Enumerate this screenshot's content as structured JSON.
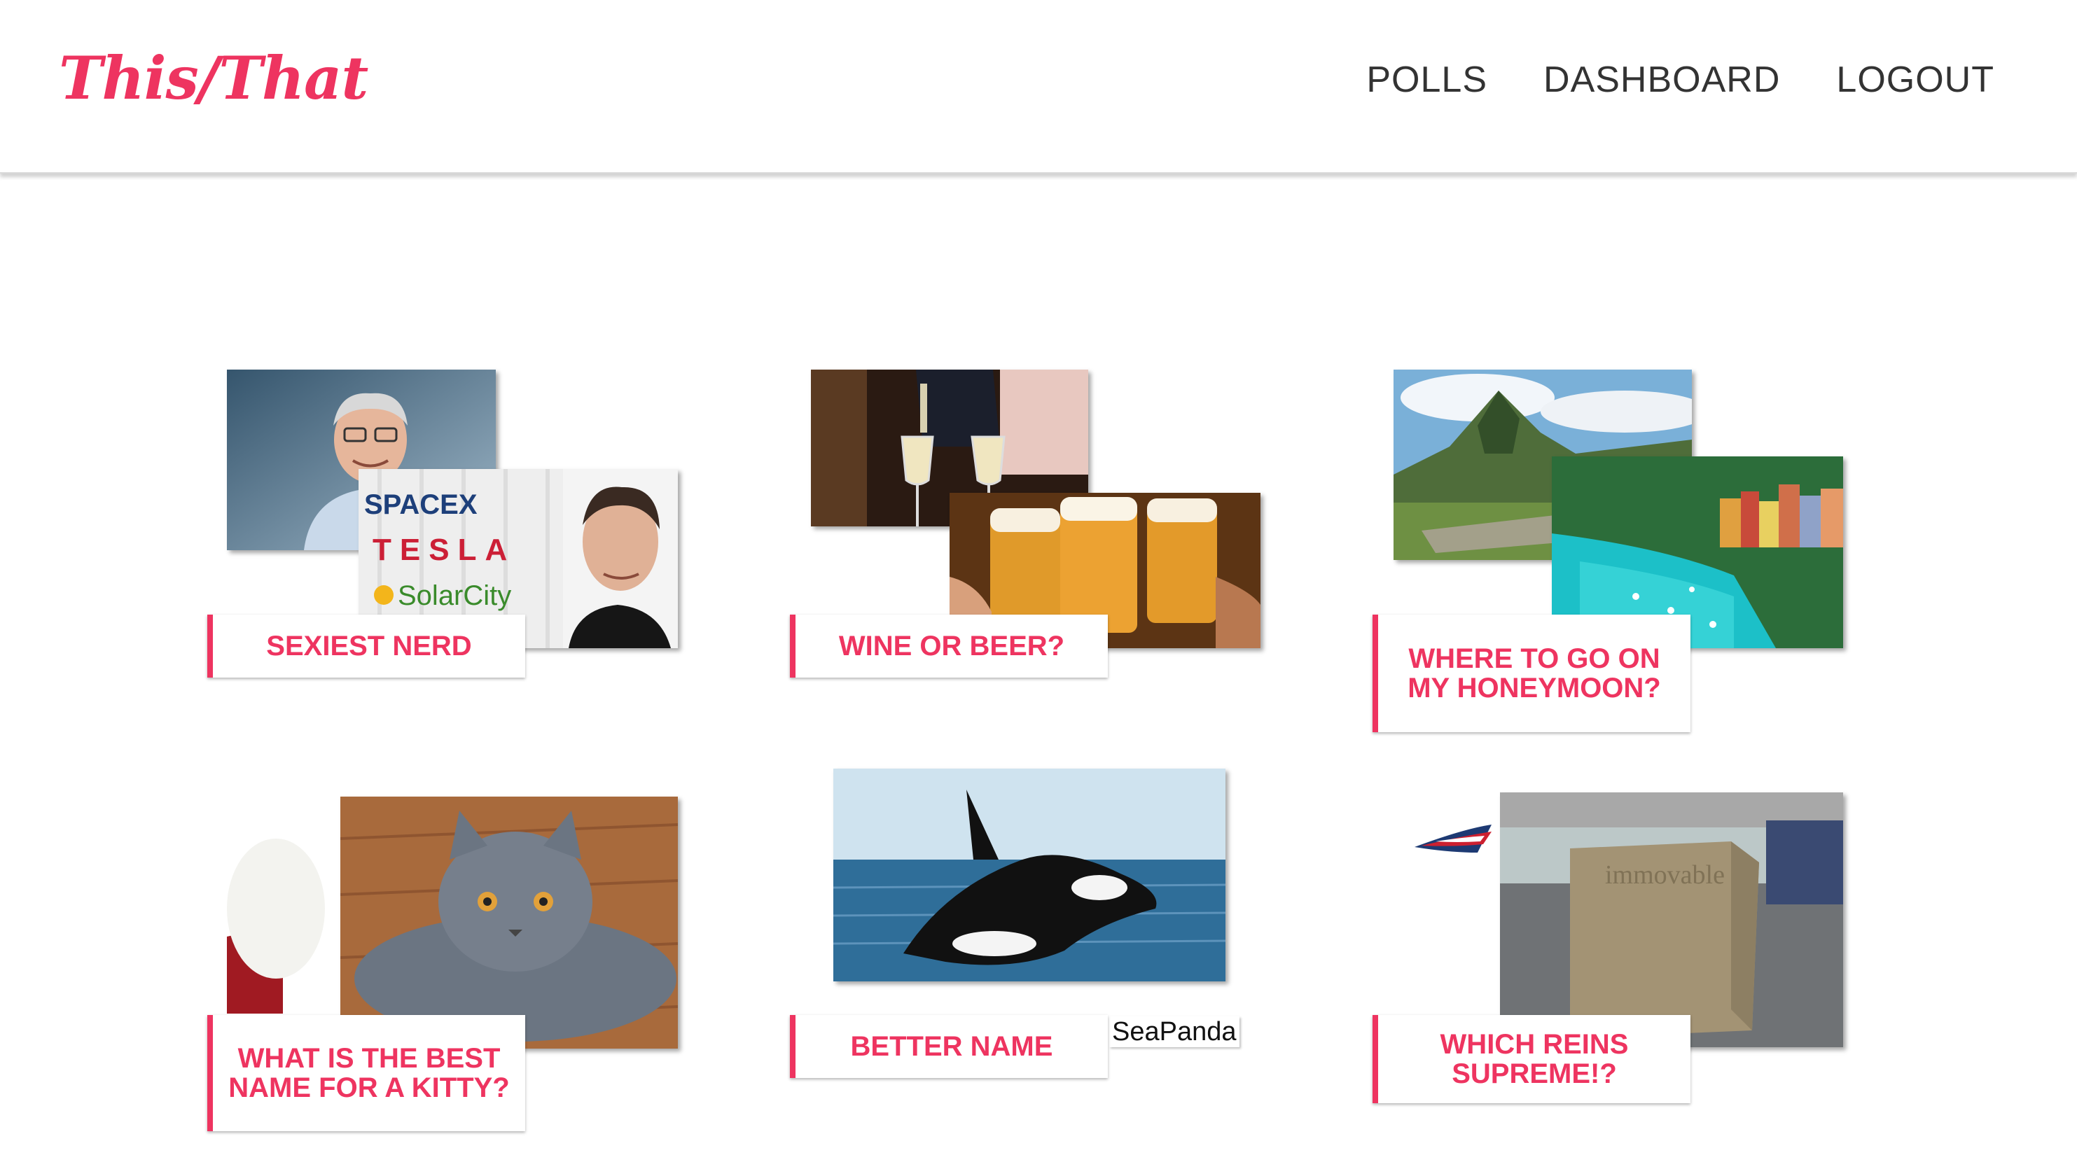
{
  "header": {
    "logo": "This/That",
    "nav": [
      "POLLS",
      "DASHBOARD",
      "LOGOUT"
    ]
  },
  "polls": [
    {
      "title": "SEXIEST NERD",
      "images": [
        "Bill Gates portrait",
        "Elon Musk with SpaceX, Tesla, SolarCity logos"
      ],
      "logo_texts": [
        "SPACEX",
        "TESLA",
        "SolarCity"
      ]
    },
    {
      "title": "WINE OR BEER?",
      "images": [
        "Pouring white wine into glasses",
        "Beer mugs toasting"
      ]
    },
    {
      "title": "WHERE TO GO ON MY HONEYMOON?",
      "images": [
        "Machu Picchu",
        "Portofino harbor"
      ]
    },
    {
      "title": "WHAT IS THE BEST NAME FOR A KITTY?",
      "images": [
        "White cat on red cushion",
        "Grey British shorthair cat"
      ]
    },
    {
      "title": "BETTER NAME",
      "images": [
        "Orca whale breaching"
      ],
      "caption": "SeaPanda"
    },
    {
      "title": "WHICH REINS SUPREME!?",
      "images": [
        "Patriots logo",
        "Concrete block engraved immovable"
      ],
      "engraving": "immovable"
    }
  ],
  "colors": {
    "accent": "#ee3460",
    "nav_text": "#333333"
  }
}
